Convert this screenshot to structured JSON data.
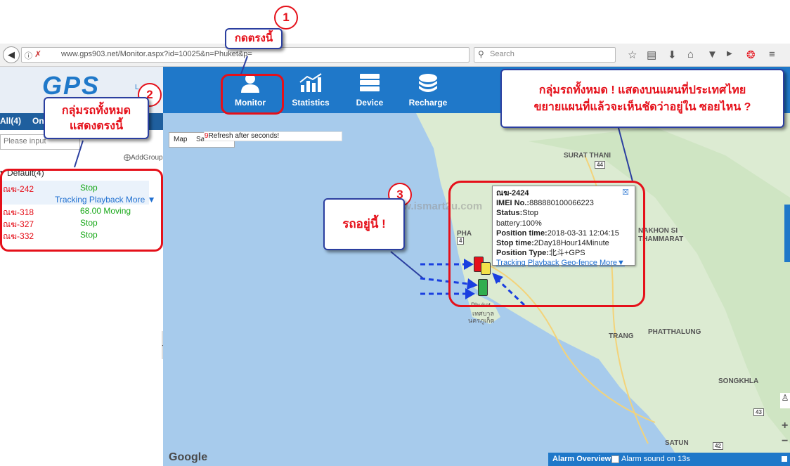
{
  "browser": {
    "url": "www.gps903.net/Monitor.aspx?id=10025&n=Phuket&p=",
    "search_placeholder": "Search"
  },
  "app": {
    "logo": "GPS",
    "logo_sub": "L"
  },
  "nav": {
    "items": [
      {
        "label": "Monitor",
        "icon": "user-icon"
      },
      {
        "label": "Statistics",
        "icon": "chart-icon"
      },
      {
        "label": "Device",
        "icon": "server-icon"
      },
      {
        "label": "Recharge",
        "icon": "coins-icon"
      }
    ]
  },
  "sidebar": {
    "tabs": [
      "All(4)",
      "On"
    ],
    "search_placeholder": "Please input",
    "add_group": "AddGroup",
    "group_label": "Default(4)",
    "tracking_links": "Tracking Playback More ▼",
    "vehicles": [
      {
        "name": "ณฆ-242",
        "status": "Stop"
      },
      {
        "name": "ณฆ-318",
        "status": "68.00  Moving"
      },
      {
        "name": "ณฆ-327",
        "status": "Stop"
      },
      {
        "name": "ณฆ-332",
        "status": "Stop"
      }
    ]
  },
  "map": {
    "map_type": "Map",
    "satellite_type": "Sa",
    "refresh_count": "9",
    "refresh_text": "Refresh after seconds!",
    "watermark": "www.ismart2u.com",
    "google": "Google",
    "labels": {
      "surat_thani": "SURAT THANI",
      "nakhon": "NAKHON SI",
      "nakhon2": "THAMMARAT",
      "phuket": "Phuket",
      "phuket_th1": "เทศบาล",
      "phuket_th2": "นครภูเก็ต",
      "trang": "TRANG",
      "phatthalung": "PHATTHALUNG",
      "songkhla": "SONGKHLA",
      "satun": "SATUN",
      "pha": "PHA",
      "route_44": "44",
      "route_4": "4",
      "route_42": "42",
      "route_43": "43"
    },
    "alarm_bar": {
      "title": "Alarm Overview",
      "sound": "Alarm sound on 13s"
    }
  },
  "popup": {
    "title": "ณฆ-2424",
    "imei_label": "IMEI No.:",
    "imei": "888880100066223",
    "status_label": "Status:",
    "status": "Stop",
    "battery": "battery:100%",
    "position_time_label": "Position time:",
    "position_time": "2018-03-31 12:04:15",
    "stop_time_label": "Stop time:",
    "stop_time": "2Day18Hour14Minute",
    "position_type_label": "Position Type:",
    "position_type": "北斗+GPS",
    "links": [
      "Tracking",
      "Playback",
      "Geo-fence",
      "More▼"
    ]
  },
  "annotations": {
    "step1": "1",
    "step1_text": "กดตรงนี้",
    "step2": "2",
    "step2_text_line1": "กลุ่มรถทั้งหมด",
    "step2_text_line2": "แสดงตรงนี้",
    "step3": "3",
    "step3_text": "รถอยู่นี้ !",
    "map_callout_line1": "กลุ่มรถทั้งหมด ! แสดงบนแผนที่ประเทศไทย",
    "map_callout_line2": "ขยายแผนที่แล้วจะเห็นชัดว่าอยู่ใน ซอยไหน ?"
  },
  "colors": {
    "header": "#1f78c9",
    "annotation_red": "#e5101a",
    "annotation_border": "#2b3fa0",
    "status_green": "#18a818",
    "link_blue": "#1f6fd0"
  }
}
